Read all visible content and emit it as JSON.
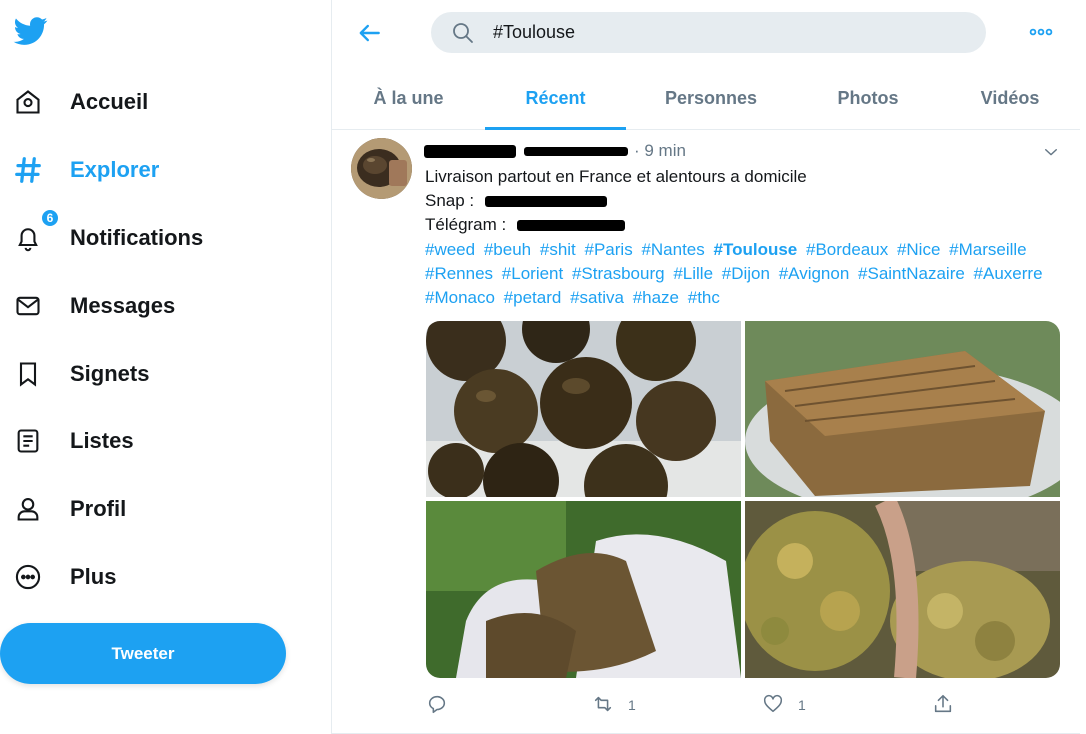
{
  "sidebar": {
    "items": [
      {
        "label": "Accueil",
        "icon": "home-icon"
      },
      {
        "label": "Explorer",
        "icon": "hashtag-icon"
      },
      {
        "label": "Notifications",
        "icon": "bell-icon",
        "badge": "6"
      },
      {
        "label": "Messages",
        "icon": "envelope-icon"
      },
      {
        "label": "Signets",
        "icon": "bookmark-icon"
      },
      {
        "label": "Listes",
        "icon": "list-icon"
      },
      {
        "label": "Profil",
        "icon": "person-icon"
      },
      {
        "label": "Plus",
        "icon": "more-circle-icon"
      }
    ],
    "tweet_button": "Tweeter"
  },
  "search": {
    "value": "#Toulouse"
  },
  "tabs": [
    {
      "label": "À la une"
    },
    {
      "label": "Récent"
    },
    {
      "label": "Personnes"
    },
    {
      "label": "Photos"
    },
    {
      "label": "Vidéos"
    }
  ],
  "tweet": {
    "time": "· 9 min",
    "text_line1": "Livraison partout en France et alentours a domicile",
    "snap_label": "Snap :",
    "telegram_label": "Télégram :",
    "hashtags": [
      "#weed",
      "#beuh",
      "#shit",
      "#Paris",
      "#Nantes",
      "#Toulouse",
      "#Bordeaux",
      "#Nice",
      "#Marseille",
      "#Rennes",
      "#Lorient",
      "#Strasbourg",
      "#Lille",
      "#Dijon",
      "#Avignon",
      "#SaintNazaire",
      "#Auxerre",
      "#Monaco",
      "#petard",
      "#sativa",
      "#haze",
      "#thc"
    ],
    "highlighted_hashtag": "#Toulouse",
    "actions": {
      "reply_count": "",
      "retweet_count": "1",
      "like_count": "1"
    }
  },
  "colors": {
    "accent": "#1da1f2",
    "text": "#14171a",
    "muted": "#657786",
    "search_bg": "#e6ecf0"
  }
}
